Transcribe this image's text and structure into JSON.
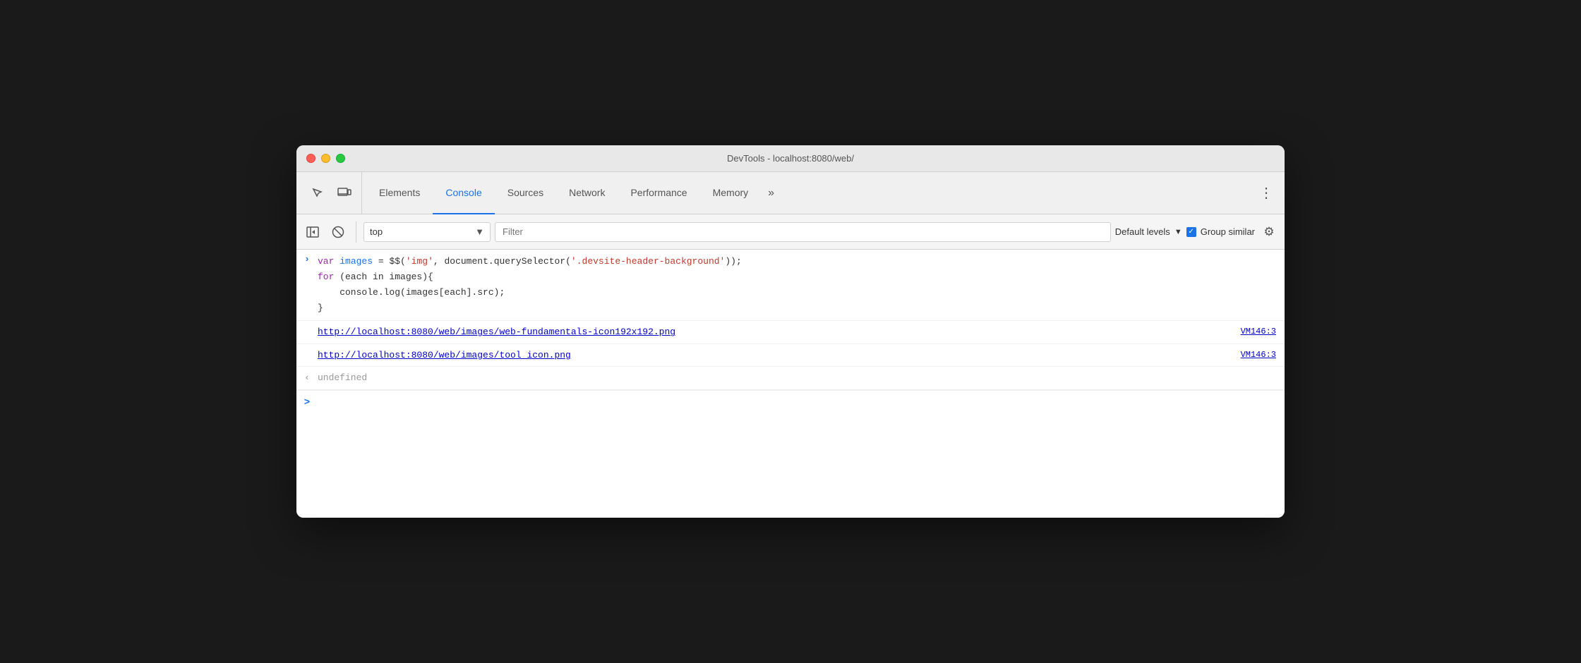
{
  "window": {
    "title": "DevTools - localhost:8080/web/",
    "traffic_lights": [
      "red",
      "yellow",
      "green"
    ]
  },
  "tabs": {
    "items": [
      {
        "id": "elements",
        "label": "Elements",
        "active": false
      },
      {
        "id": "console",
        "label": "Console",
        "active": true
      },
      {
        "id": "sources",
        "label": "Sources",
        "active": false
      },
      {
        "id": "network",
        "label": "Network",
        "active": false
      },
      {
        "id": "performance",
        "label": "Performance",
        "active": false
      },
      {
        "id": "memory",
        "label": "Memory",
        "active": false
      }
    ],
    "more_label": "»",
    "settings_label": "⋮"
  },
  "toolbar": {
    "context_value": "top",
    "filter_placeholder": "Filter",
    "levels_label": "Default levels",
    "group_similar_label": "Group similar",
    "group_similar_checked": true
  },
  "console": {
    "entries": [
      {
        "type": "input",
        "code_lines": [
          "var images = $$('img', document.querySelector('.devsite-header-background'));",
          "for (each in images){",
          "    console.log(images[each].src);",
          "}"
        ]
      },
      {
        "type": "output_link",
        "text": "http://localhost:8080/web/images/web-fundamentals-icon192x192.png",
        "location": "VM146:3"
      },
      {
        "type": "output_link",
        "text": "http://localhost:8080/web/images/tool_icon.png",
        "location": "VM146:3"
      },
      {
        "type": "return_value",
        "text": "undefined"
      }
    ],
    "prompt_symbol": ">"
  }
}
